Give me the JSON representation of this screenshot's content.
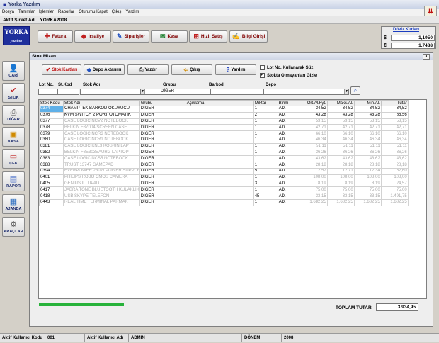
{
  "app": {
    "title": "Yorka Yazılım"
  },
  "menu": [
    "Dosya",
    "Tanımlar",
    "İşlemler",
    "Raporlar",
    "Oturumu Kapat",
    "Çıkış",
    "Yardım"
  ],
  "company": {
    "label": "Aktif Şirket Adı",
    "value": "YORKA2008"
  },
  "logo": {
    "text": "YORKA",
    "sub": "yazılım"
  },
  "top_buttons": [
    "Fatura",
    "İrsaliye",
    "Siparişler",
    "Kasa",
    "Hızlı Satış",
    "Bilgi Girişi"
  ],
  "doviz": {
    "title": "Döviz Kurları",
    "usd_symbol": "$",
    "usd": "1,1950",
    "eur_symbol": "€",
    "eur": "1,7488"
  },
  "sidebar": [
    "CARİ",
    "STOK",
    "DİĞER",
    "KASA",
    "ÇEK",
    "RAPOR",
    "AJANDA",
    "ARAÇLAR"
  ],
  "window": {
    "title": "Stok Mizan",
    "close": "x"
  },
  "toolbar": {
    "stok_kartlari": "Stok Kartları",
    "depo_aktarim": "Depo Aktarımı",
    "yazdir": "Yazdır",
    "cikis": "Çıkış",
    "yardim": "Yardım"
  },
  "options": {
    "lot_label": "Lot No. Kullanarak Süz",
    "lot_checked": false,
    "stok_label": "Stokta Olmayanları Gizle",
    "stok_checked": true
  },
  "filters": {
    "lot_no": "Lot No.",
    "st_kod": "St.Kod",
    "stok_adi": "Stok Adı",
    "grubu": "Grubu",
    "grubu_value": "DİĞER",
    "barkod": "Barkod",
    "depo": "Depo"
  },
  "table": {
    "headers": [
      "Stok Kodu",
      "Stok Adı",
      "Grubu",
      "Açıklama",
      "Miktar",
      "Birim",
      "Ort.Al.Fyt.",
      "Maks.Al.",
      "Min.Al.",
      "Tutar"
    ],
    "rows": [
      [
        "0374",
        "CHAMPTEK BARKOD OKUYUCU",
        "DİĞER",
        "",
        "1",
        "AD.",
        "34,52",
        "34,52",
        "34,52",
        "34,52"
      ],
      [
        "0376",
        "KVM SWITCH 2 PORT OTOMATİK",
        "DİĞER",
        "",
        "2",
        "AD.",
        "43,28",
        "43,28",
        "43,28",
        "86,56"
      ],
      [
        "0377",
        "CASE LOGIC NCV2 NOTEBOOK",
        "DİĞER",
        "",
        "1",
        "AD.",
        "53,15",
        "53,15",
        "53,15",
        "53,15"
      ],
      [
        "0378",
        "BELKIN F8Z004 SCREEN CASE",
        "DİĞER",
        "",
        "1",
        "AD.",
        "42,71",
        "42,71",
        "42,71",
        "42,71"
      ],
      [
        "0379",
        "CASE LOGIC NCR3 NOTEBOOK",
        "DİĞER",
        "",
        "1",
        "AD.",
        "66,10",
        "66,10",
        "66,10",
        "66,10"
      ],
      [
        "0380",
        "CASE LOGIC NCR1 NOTEBOOK",
        "DİĞER",
        "",
        "1",
        "AD.",
        "46,34",
        "46,34",
        "46,34",
        "46,34"
      ],
      [
        "0381",
        "CASE LOGIC KNL3 KOSKIN LAP",
        "DİĞER",
        "",
        "1",
        "AD.",
        "51,11",
        "51,11",
        "51,11",
        "51,11"
      ],
      [
        "0382",
        "BELKIN F8E303EAURG LAPTOP",
        "DİĞER",
        "",
        "1",
        "AD.",
        "36,26",
        "36,26",
        "36,26",
        "36,26"
      ],
      [
        "0383",
        "CASE LOGIC NCS5 NOTEBOOK",
        "DİĞER",
        "",
        "1",
        "AD.",
        "43,62",
        "43,62",
        "43,62",
        "43,62"
      ],
      [
        "0388",
        "TRUST 13747 GAMEPAD",
        "DİĞER",
        "",
        "1",
        "AD.",
        "28,18",
        "28,18",
        "28,18",
        "28,18"
      ],
      [
        "0394",
        "EVERPOWER 230W POWER SUPPLY",
        "DİĞER",
        "",
        "5",
        "AD.",
        "12,52",
        "12,71",
        "12,34",
        "62,60"
      ],
      [
        "0401",
        "PHILIPS ROBO CMOS CAMERA",
        "DİĞER",
        "",
        "1",
        "AD.",
        "108,00",
        "108,00",
        "108,00",
        "108,00"
      ],
      [
        "0405",
        "GENIUS ILLUPAD",
        "DİĞER",
        "",
        "3",
        "AD.",
        "8,19",
        "8,19",
        "8,19",
        "24,57"
      ],
      [
        "0417",
        "JABRA TONE BLUETOOTH KULAKLIK",
        "DİĞER",
        "",
        "1",
        "AD.",
        "75,00",
        "75,00",
        "75,00",
        "75,00"
      ],
      [
        "0418",
        "USB SKYPE TELEFON",
        "DİĞER",
        "",
        "45",
        "AD.",
        "33,15",
        "33,15",
        "33,15",
        "1.491,75"
      ],
      [
        "0443",
        "REAL TIME TERMINAL PARMAK",
        "DİĞER",
        "",
        "1",
        "AD.",
        "1.682,25",
        "1.682,25",
        "1.682,25",
        "1.682,25"
      ]
    ]
  },
  "footer": {
    "progress": 1,
    "toplam_label": "TOPLAM TUTAR",
    "toplam_value": "3.934,95"
  },
  "status": {
    "kodu_label": "Aktif Kullanıcı Kodu",
    "kodu": "001",
    "adi_label": "Aktif Kullanıcı Adı",
    "adi": "ADMIN",
    "donem_label": "DÖNEM",
    "donem": "2008"
  }
}
